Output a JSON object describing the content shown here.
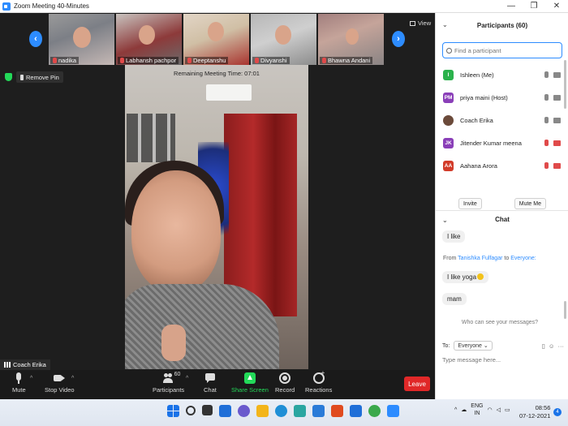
{
  "window": {
    "title": "Zoom Meeting 40-Minutes"
  },
  "thumbnails": [
    {
      "name": "nadika"
    },
    {
      "name": "Labhansh pachpor"
    },
    {
      "name": "Deeptanshu"
    },
    {
      "name": "Divyanshi"
    },
    {
      "name": "Bhawna Andani"
    }
  ],
  "view_label": "View",
  "remove_pin_label": "Remove Pin",
  "meeting_timer": "Remaining Meeting Time: 07:01",
  "active_speaker": "Coach Erika",
  "toolbar": {
    "mute": "Mute",
    "stop_video": "Stop Video",
    "participants": "Participants",
    "participants_count": "60",
    "chat": "Chat",
    "share_screen": "Share Screen",
    "record": "Record",
    "reactions": "Reactions",
    "leave": "Leave"
  },
  "participants_panel": {
    "title": "Participants (60)",
    "search_placeholder": "Find a participant",
    "participants": [
      {
        "initials": "I",
        "name": "Ishleen (Me)",
        "color": "#2bb24c",
        "muted": false
      },
      {
        "initials": "PM",
        "name": "priya maini (Host)",
        "color": "#8a3fb8",
        "muted": false
      },
      {
        "initials": "",
        "name": "Coach Erika",
        "color": "#6b4a3a",
        "muted": false
      },
      {
        "initials": "JK",
        "name": "Jitender Kumar meena",
        "color": "#8a3fb8",
        "muted": true
      },
      {
        "initials": "AA",
        "name": "Aahana Arora",
        "color": "#d23c2a",
        "muted": true
      }
    ],
    "invite": "Invite",
    "mute_me": "Mute Me"
  },
  "chat_panel": {
    "title": "Chat",
    "msg1": "I like",
    "from_prefix": "From",
    "from_name": "Tanishka Fulfagar",
    "to_word": "to",
    "to_target": "Everyone:",
    "msg2": "I like yoga",
    "msg3": "mam",
    "who_can_see": "Who can see your messages?",
    "to_label": "To:",
    "to_value": "Everyone",
    "input_placeholder": "Type message here..."
  },
  "taskbar": {
    "lang_top": "ENG",
    "lang_bottom": "IN",
    "time": "08:56",
    "date": "07-12-2021",
    "notif_count": "4"
  }
}
